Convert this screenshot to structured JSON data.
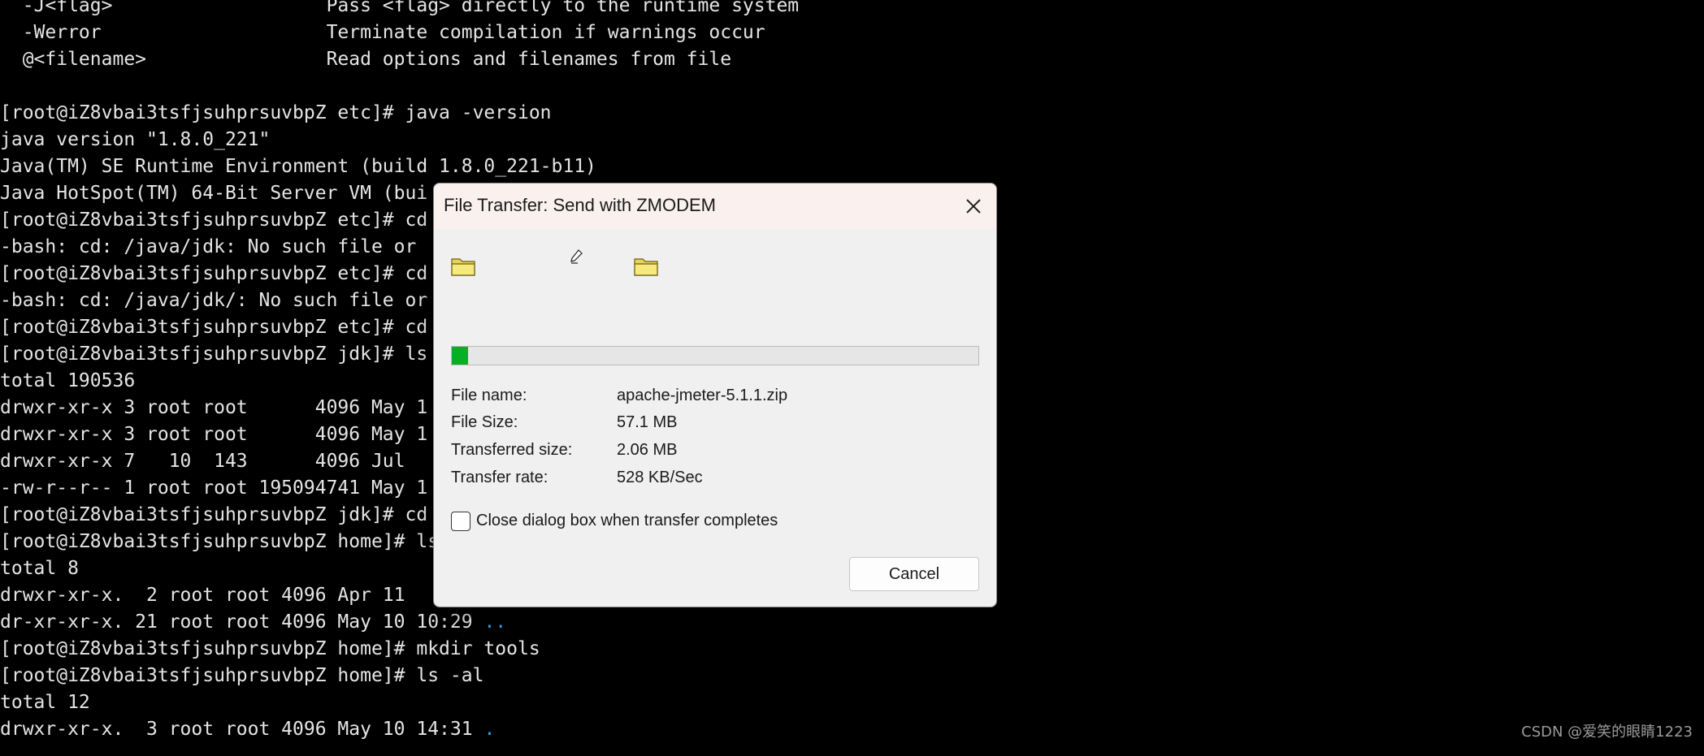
{
  "terminal": {
    "lines": [
      "  -J<flag>                   Pass <flag> directly to the runtime system",
      "  -Werror                    Terminate compilation if warnings occur",
      "  @<filename>                Read options and filenames from file",
      "",
      "[root@iZ8vbai3tsfjsuhprsuvbpZ etc]# java -version",
      "java version \"1.8.0_221\"",
      "Java(TM) SE Runtime Environment (build 1.8.0_221-b11)",
      "Java HotSpot(TM) 64-Bit Server VM (bui",
      "[root@iZ8vbai3tsfjsuhprsuvbpZ etc]# cd",
      "-bash: cd: /java/jdk: No such file or",
      "[root@iZ8vbai3tsfjsuhprsuvbpZ etc]# cd",
      "-bash: cd: /java/jdk/: No such file or",
      "[root@iZ8vbai3tsfjsuhprsuvbpZ etc]# cd",
      "[root@iZ8vbai3tsfjsuhprsuvbpZ jdk]# ls",
      "total 190536",
      "drwxr-xr-x 3 root root      4096 May 1",
      "drwxr-xr-x 3 root root      4096 May 1",
      "drwxr-xr-x 7   10  143      4096 Jul",
      "-rw-r--r-- 1 root root 195094741 May 1",
      "[root@iZ8vbai3tsfjsuhprsuvbpZ jdk]# cd",
      "[root@iZ8vbai3tsfjsuhprsuvbpZ home]# ls",
      "total 8",
      "drwxr-xr-x.  2 root root 4096 Apr 11",
      "dr-xr-xr-x. 21 root root 4096 May 10 10:29 ",
      "[root@iZ8vbai3tsfjsuhprsuvbpZ home]# mkdir tools",
      "[root@iZ8vbai3tsfjsuhprsuvbpZ home]# ls -al",
      "total 12",
      "drwxr-xr-x.  3 root root 4096 May 10 14:31 "
    ],
    "dir_suffix_23": "..",
    "dir_suffix_27": "."
  },
  "dialog": {
    "title": "File Transfer: Send with ZMODEM",
    "progress": {
      "fraction": 0.031,
      "color": "#06b025"
    },
    "file_name_label": "File name:",
    "file_name": "apache-jmeter-5.1.1.zip",
    "file_size_label": "File Size:",
    "file_size": "57.1 MB",
    "transferred_label": "Transferred size:",
    "transferred": "2.06 MB",
    "rate_label": "Transfer rate:",
    "rate": "528 KB/Sec",
    "close_when_done_label": "Close dialog box when transfer completes",
    "close_when_done_checked": false,
    "cancel_label": "Cancel"
  },
  "watermark": "CSDN @爱笑的眼睛1223"
}
